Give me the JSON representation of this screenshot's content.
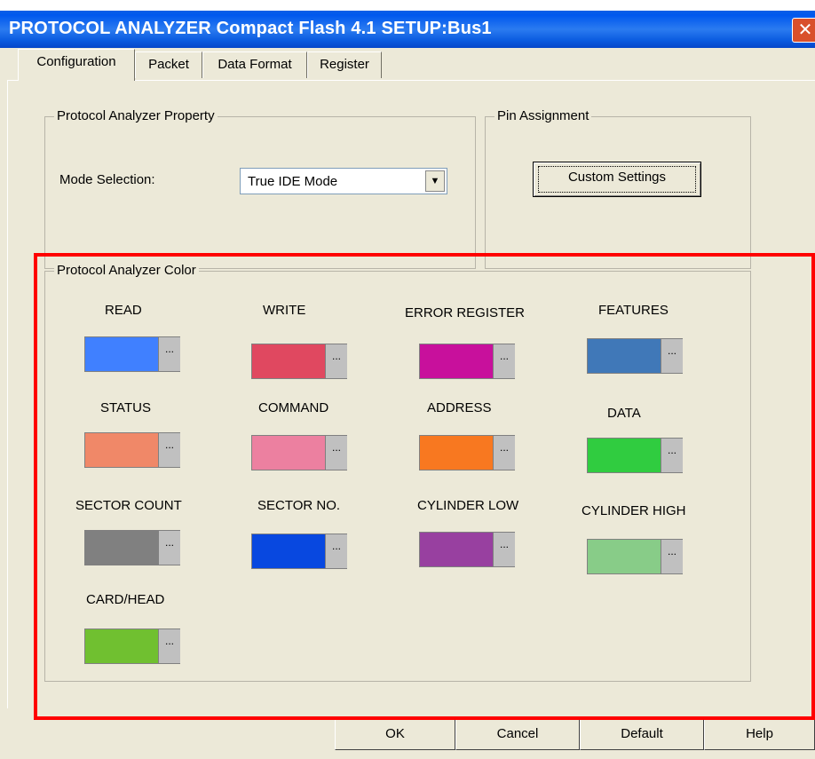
{
  "window": {
    "title": "PROTOCOL ANALYZER Compact Flash 4.1 SETUP:Bus1",
    "close": "✕"
  },
  "tabs": [
    "Configuration",
    "Packet",
    "Data Format",
    "Register"
  ],
  "property_group": {
    "title": "Protocol Analyzer Property",
    "mode_label": "Mode Selection:",
    "mode_value": "True IDE Mode",
    "arrow": "▼"
  },
  "pin_group": {
    "title": "Pin Assignment",
    "custom_button": "Custom Settings"
  },
  "color_group": {
    "title": "Protocol Analyzer Color",
    "dots": "...",
    "items": [
      {
        "label": "READ",
        "color": "#4080ff"
      },
      {
        "label": "WRITE",
        "color": "#e04860"
      },
      {
        "label": "ERROR REGISTER",
        "color": "#c8109c"
      },
      {
        "label": "FEATURES",
        "color": "#4078b8"
      },
      {
        "label": "STATUS",
        "color": "#f08868"
      },
      {
        "label": "COMMAND",
        "color": "#ec80a0"
      },
      {
        "label": "ADDRESS",
        "color": "#f87820"
      },
      {
        "label": "DATA",
        "color": "#30cc40"
      },
      {
        "label": "SECTOR COUNT",
        "color": "#808080"
      },
      {
        "label": "SECTOR NO.",
        "color": "#0848e0"
      },
      {
        "label": "CYLINDER LOW",
        "color": "#9840a0"
      },
      {
        "label": "CYLINDER HIGH",
        "color": "#88cc88"
      },
      {
        "label": "CARD/HEAD",
        "color": "#70c030"
      }
    ]
  },
  "buttons": {
    "ok": "OK",
    "cancel": "Cancel",
    "default": "Default",
    "help": "Help"
  }
}
